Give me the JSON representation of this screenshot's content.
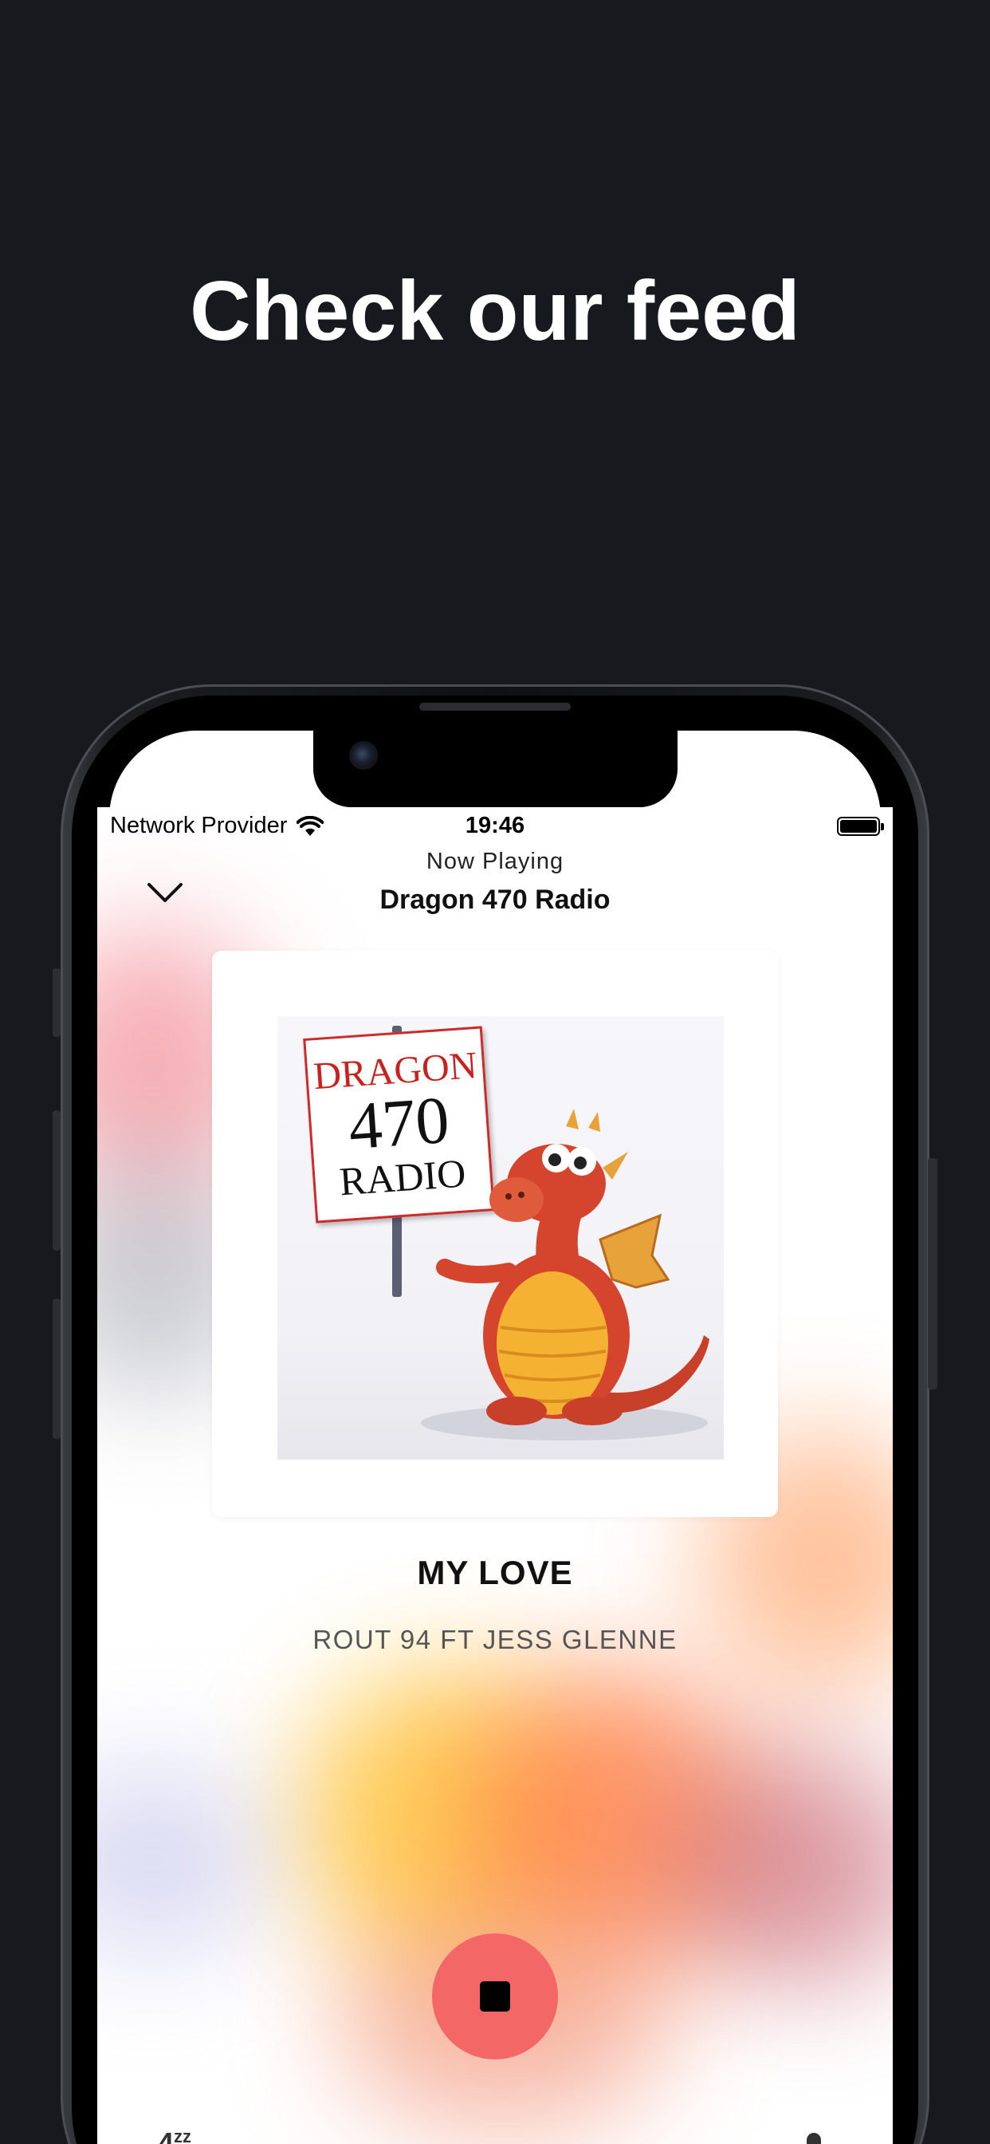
{
  "headline": "Check our feed",
  "status_bar": {
    "carrier": "Network Provider",
    "time": "19:46",
    "wifi_icon": "wifi-icon",
    "battery_icon": "battery-icon"
  },
  "player": {
    "header_label": "Now Playing",
    "station_name": "Dragon 470 Radio",
    "collapse_icon": "chevron-down-icon",
    "artwork": {
      "sign_line1": "DRAGON",
      "sign_line2": "470",
      "sign_line3": "RADIO"
    },
    "track_title": "MY LOVE",
    "track_artist": "ROUT 94 FT JESS GLENNE",
    "stop_icon": "stop-icon",
    "sleep_icon": "sleep-timer-icon",
    "mic_icon": "microphone-icon"
  },
  "colors": {
    "page_background": "#17191e",
    "stop_button": "#f46767",
    "accent_orange": "#ff8a3d",
    "accent_yellow": "#ffc43d"
  }
}
